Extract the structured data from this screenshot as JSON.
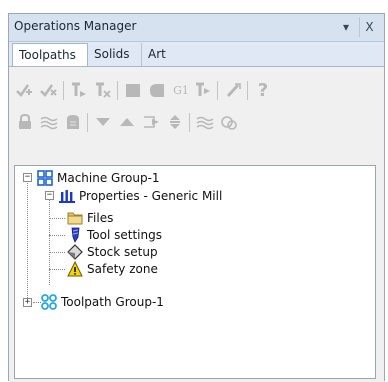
{
  "window": {
    "title": "Operations Manager",
    "pin_glyph": "▾",
    "close_glyph": "X"
  },
  "tabs": [
    {
      "label": "Toolpaths",
      "active": true
    },
    {
      "label": "Solids",
      "active": false
    },
    {
      "label": "Art",
      "active": false
    }
  ],
  "toolbar1": {
    "icons": [
      "select-all-operations-icon",
      "select-dirty-operations-icon",
      "regenerate-selected-icon",
      "regenerate-dirty-icon",
      "backplot-icon",
      "verify-icon",
      "post-selected-icon",
      "high-speed-toolpath-icon",
      "delete-icon",
      "help-icon"
    ],
    "gcode_label": "G1"
  },
  "toolbar2": {
    "icons": [
      "lock-icon",
      "toggle-display-icon",
      "toggle-posting-icon",
      "move-down-icon",
      "move-up-icon",
      "insert-arrow-icon",
      "scroll-icon",
      "only-display-selected-icon",
      "only-display-associated-icon"
    ]
  },
  "tree": {
    "machine_group": "Machine Group-1",
    "properties": "Properties - Generic Mill",
    "files": "Files",
    "tool_settings": "Tool settings",
    "stock_setup": "Stock setup",
    "safety_zone": "Safety zone",
    "toolpath_group": "Toolpath Group-1",
    "collapse_glyph": "−",
    "expand_glyph": "+"
  },
  "colors": {
    "panel_bg": "#dfe8f4",
    "machine_icon": "#1e63d6",
    "properties_icon": "#1a38c4",
    "folder_icon": "#e3c46a",
    "tool_icon": "#2a3fd0",
    "warning_icon": "#f5d400",
    "toolpath_icon": "#2aa6e0"
  }
}
